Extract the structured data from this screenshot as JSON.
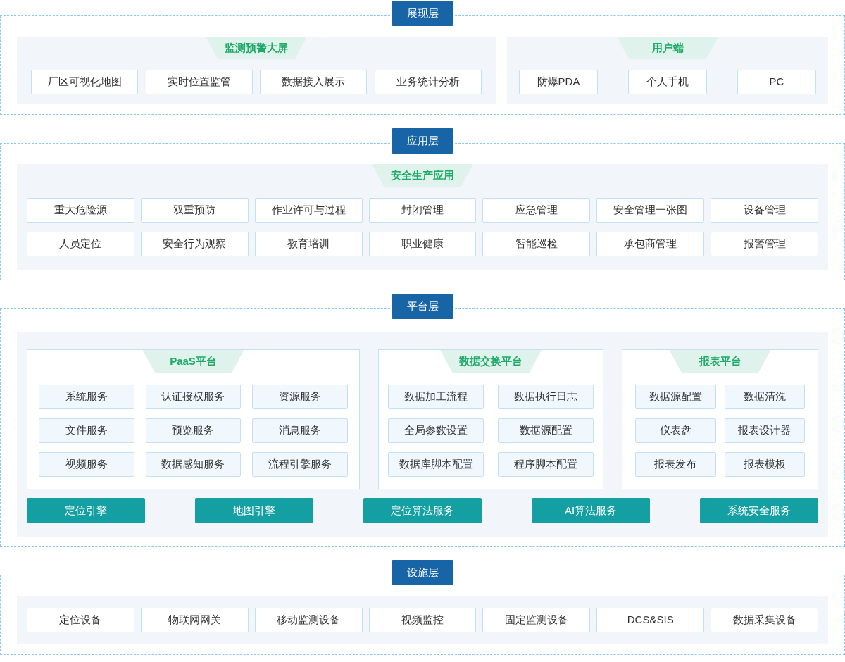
{
  "layers": [
    {
      "title": "展现层",
      "kind": "split",
      "panels": [
        {
          "title": "监测预警大屏",
          "items": [
            "厂区可视化地图",
            "实时位置监管",
            "数据接入展示",
            "业务统计分析"
          ]
        },
        {
          "title": "用户端",
          "items": [
            "防爆PDA",
            "个人手机",
            "PC"
          ]
        }
      ]
    },
    {
      "title": "应用层",
      "kind": "single",
      "panels": [
        {
          "title": "安全生产应用",
          "items": [
            "重大危险源",
            "双重预防",
            "作业许可与过程",
            "封闭管理",
            "应急管理",
            "安全管理一张图",
            "设备管理",
            "人员定位",
            "安全行为观察",
            "教育培训",
            "职业健康",
            "智能巡检",
            "承包商管理",
            "报警管理"
          ]
        }
      ]
    },
    {
      "title": "平台层",
      "kind": "platform",
      "sections": [
        {
          "title": "PaaS平台",
          "items": [
            "系统服务",
            "认证授权服务",
            "资源服务",
            "文件服务",
            "预览服务",
            "消息服务",
            "视频服务",
            "数据感知服务",
            "流程引擎服务"
          ]
        },
        {
          "title": "数据交换平台",
          "items": [
            "数据加工流程",
            "数据执行日志",
            "全局参数设置",
            "数据源配置",
            "数据库脚本配置",
            "程序脚本配置"
          ]
        },
        {
          "title": "报表平台",
          "items": [
            "数据源配置",
            "数据清洗",
            "仪表盘",
            "报表设计器",
            "报表发布",
            "报表模板"
          ]
        }
      ],
      "engines": [
        "定位引擎",
        "地图引擎",
        "定位算法服务",
        "AI算法服务",
        "系统安全服务"
      ]
    },
    {
      "title": "设施层",
      "kind": "single",
      "panels": [
        {
          "items": [
            "定位设备",
            "物联网网关",
            "移动监测设备",
            "视频监控",
            "固定监测设备",
            "DCS&SIS",
            "数据采集设备"
          ]
        }
      ]
    }
  ]
}
